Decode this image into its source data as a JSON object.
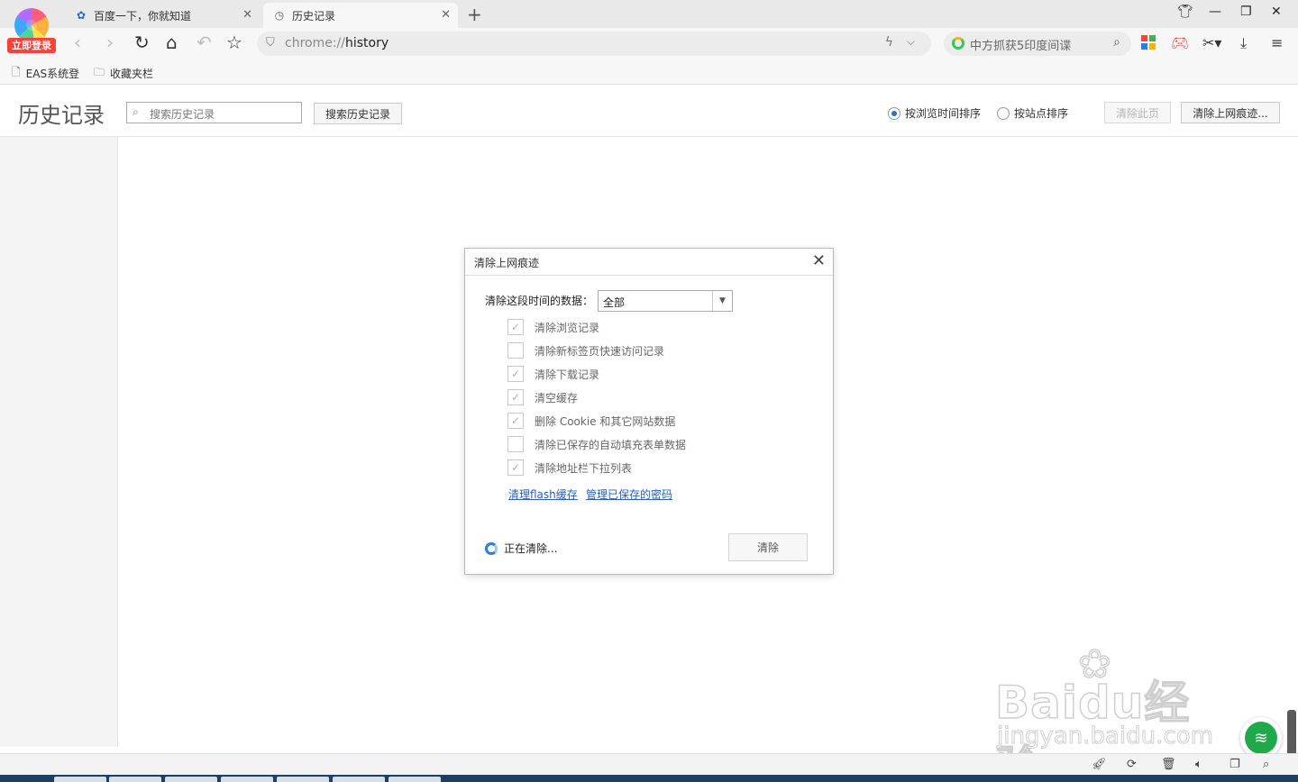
{
  "browser": {
    "login_badge": "立即登录",
    "tabs": [
      {
        "label": "百度一下，你就知道",
        "icon": "baidu-paw-icon",
        "active": false
      },
      {
        "label": "历史记录",
        "icon": "clock-icon",
        "active": true
      }
    ],
    "address": {
      "scheme": "chrome://",
      "path": "history"
    },
    "search": {
      "text": "中方抓获5印度间谍"
    },
    "bookmarks": [
      {
        "label": "EAS系统登",
        "icon": "page-icon"
      },
      {
        "label": "收藏夹栏",
        "icon": "folder-icon"
      }
    ]
  },
  "history_page": {
    "title": "历史记录",
    "search_placeholder": "搜索历史记录",
    "search_button": "搜索历史记录",
    "sort_options": [
      {
        "label": "按浏览时间排序",
        "selected": true
      },
      {
        "label": "按站点排序",
        "selected": false
      }
    ],
    "clear_page_button": "清除此页",
    "clear_traces_button": "清除上网痕迹..."
  },
  "dialog": {
    "title": "清除上网痕迹",
    "range_label": "清除这段时间的数据：",
    "range_value": "全部",
    "options": [
      {
        "label": "清除浏览记录",
        "checked": true
      },
      {
        "label": "清除新标签页快速访问记录",
        "checked": false
      },
      {
        "label": "清除下载记录",
        "checked": true
      },
      {
        "label": "清空缓存",
        "checked": true
      },
      {
        "label": "删除 Cookie 和其它网站数据",
        "checked": true
      },
      {
        "label": "清除已保存的自动填充表单数据",
        "checked": false
      },
      {
        "label": "清除地址栏下拉列表",
        "checked": true
      }
    ],
    "links": [
      "清理flash缓存",
      "管理已保存的密码"
    ],
    "status": "正在清除...",
    "clear_button": "清除"
  },
  "watermark": {
    "main": "Baidu经验",
    "sub": "jingyan.baidu.com"
  },
  "colors": {
    "accent": "#2a6fd6",
    "link": "#2a62b8",
    "badge": "#f0453a",
    "wifi": "#1fa94a"
  }
}
